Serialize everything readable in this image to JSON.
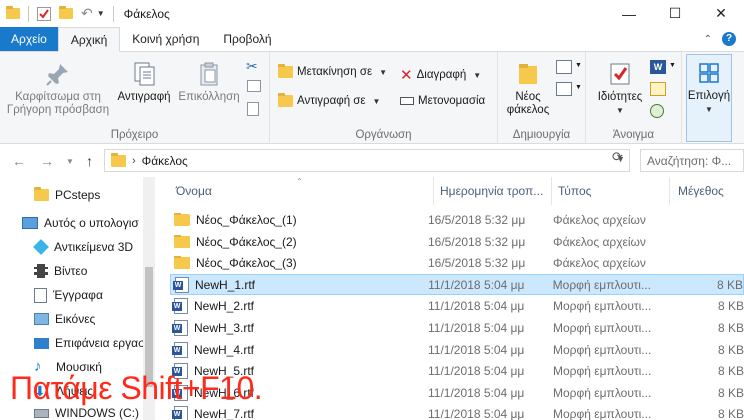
{
  "window": {
    "title": "Φάκελος",
    "controls": {
      "minimize": "—",
      "maximize": "☐",
      "close": "✕"
    }
  },
  "tabs": [
    {
      "label": "Αρχείο"
    },
    {
      "label": "Αρχική"
    },
    {
      "label": "Κοινή χρήση"
    },
    {
      "label": "Προβολή"
    }
  ],
  "ribbon": {
    "clipboard": {
      "label": "Πρόχειρο",
      "pin": "Καρφίτσωμα στη Γρήγορη πρόσβαση",
      "pin_line1": "Καρφίτσωμα στη",
      "pin_line2": "Γρήγορη πρόσβαση",
      "copy": "Αντιγραφή",
      "paste": "Επικόλληση"
    },
    "organize": {
      "label": "Οργάνωση",
      "move_to": "Μετακίνηση σε",
      "copy_to": "Αντιγραφή σε",
      "delete": "Διαγραφή",
      "rename": "Μετονομασία"
    },
    "new": {
      "label": "Δημιουργία",
      "new_folder_line1": "Νέος",
      "new_folder_line2": "φάκελος"
    },
    "open": {
      "label": "Άνοιγμα",
      "properties": "Ιδιότητες"
    },
    "select": {
      "label": "Επιλογή"
    }
  },
  "address": {
    "path": "Φάκελος",
    "search_placeholder": "Αναζήτηση: Φ..."
  },
  "nav_pane": {
    "items": [
      {
        "label": "PCsteps",
        "icon": "folder-icon"
      },
      {
        "label": "Αυτός ο υπολογισ",
        "icon": "computer-icon"
      },
      {
        "label": "Αντικείμενα 3D",
        "icon": "3d-objects-icon"
      },
      {
        "label": "Βίντεο",
        "icon": "video-icon"
      },
      {
        "label": "Έγγραφα",
        "icon": "documents-icon"
      },
      {
        "label": "Εικόνες",
        "icon": "pictures-icon"
      },
      {
        "label": "Επιφάνεια εργασ",
        "icon": "desktop-icon"
      },
      {
        "label": "Μουσική",
        "icon": "music-icon"
      },
      {
        "label": "Λήψεις",
        "icon": "downloads-icon"
      },
      {
        "label": "WINDOWS (C:)",
        "icon": "drive-icon"
      }
    ]
  },
  "columns": {
    "name": "Όνομα",
    "date": "Ημερομηνία τροπ...",
    "type": "Τύπος",
    "size": "Μέγεθος"
  },
  "files": [
    {
      "name": "Νέος_Φάκελος_(1)",
      "date": "16/5/2018 5:32 μμ",
      "type": "Φάκελος αρχείων",
      "size": "",
      "kind": "folder"
    },
    {
      "name": "Νέος_Φάκελος_(2)",
      "date": "16/5/2018 5:32 μμ",
      "type": "Φάκελος αρχείων",
      "size": "",
      "kind": "folder"
    },
    {
      "name": "Νέος_Φάκελος_(3)",
      "date": "16/5/2018 5:32 μμ",
      "type": "Φάκελος αρχείων",
      "size": "",
      "kind": "folder"
    },
    {
      "name": "NewH_1.rtf",
      "date": "11/1/2018 5:04 μμ",
      "type": "Μορφή εμπλουτι...",
      "size": "8 KB",
      "kind": "rtf",
      "selected": true
    },
    {
      "name": "NewH_2.rtf",
      "date": "11/1/2018 5:04 μμ",
      "type": "Μορφή εμπλουτι...",
      "size": "8 KB",
      "kind": "rtf"
    },
    {
      "name": "NewH_3.rtf",
      "date": "11/1/2018 5:04 μμ",
      "type": "Μορφή εμπλουτι...",
      "size": "8 KB",
      "kind": "rtf"
    },
    {
      "name": "NewH_4.rtf",
      "date": "11/1/2018 5:04 μμ",
      "type": "Μορφή εμπλουτι...",
      "size": "8 KB",
      "kind": "rtf"
    },
    {
      "name": "NewH_5.rtf",
      "date": "11/1/2018 5:04 μμ",
      "type": "Μορφή εμπλουτι...",
      "size": "8 KB",
      "kind": "rtf"
    },
    {
      "name": "NewH_6.rtf",
      "date": "11/1/2018 5:04 μμ",
      "type": "Μορφή εμπλουτι...",
      "size": "8 KB",
      "kind": "rtf"
    },
    {
      "name": "NewH_7.rtf",
      "date": "11/1/2018 5:04 μμ",
      "type": "Μορφή εμπλουτι...",
      "size": "8 KB",
      "kind": "rtf"
    }
  ],
  "overlay_caption": "Πατάμε Shift+F10.",
  "colors": {
    "file_tab": "#1979ca",
    "selection": "#cce8ff",
    "caption": "#ff2a1a"
  }
}
